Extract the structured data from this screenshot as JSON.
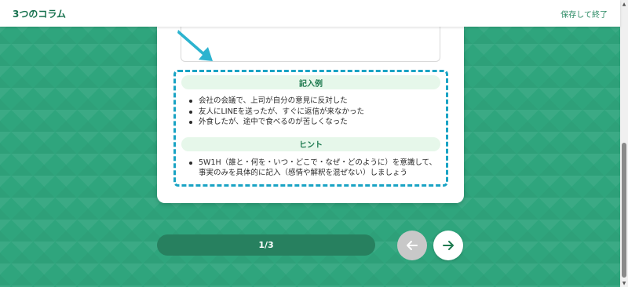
{
  "header": {
    "title": "3つのコラム",
    "save_exit": "保存して終了"
  },
  "card": {
    "example_heading": "記入例",
    "examples": [
      "会社の会議で、上司が自分の意見に反対した",
      "友人にLINEを送ったが、すぐに返信が来なかった",
      "外食したが、途中で食べるのが苦しくなった"
    ],
    "hint_heading": "ヒント",
    "hints": [
      "5W1H（誰と・何を・いつ・どこで・なぜ・どのように）を意識して、事実のみを具体的に記入（感情や解釈を混ぜない）しましょう"
    ]
  },
  "pager": {
    "indicator": "1/3"
  },
  "icons": {
    "pointer": "pointer-arrow-icon",
    "prev": "arrow-left-icon",
    "next": "arrow-right-icon"
  },
  "colors": {
    "background": "#2fa57d",
    "brand": "#18724f",
    "dashed_border": "#19a3c4",
    "heading_pill": "#e6f7ea",
    "progress_bar": "#27805f",
    "prev_disabled": "#c8c8c8"
  }
}
